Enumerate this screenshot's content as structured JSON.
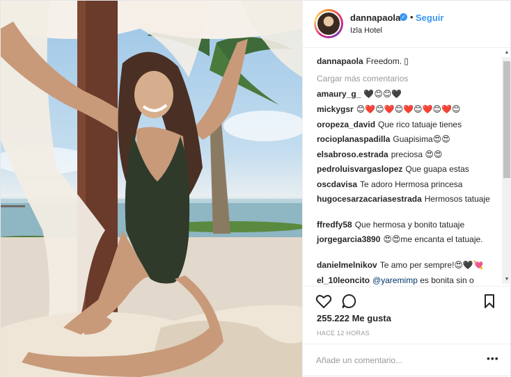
{
  "post": {
    "username": "dannapaola",
    "verified_mark": "✓",
    "separator": "•",
    "follow_label": "Seguir",
    "location": "Izla Hotel",
    "likes": "255.222 Me gusta",
    "time": "HACE 12 HORAS"
  },
  "caption": {
    "user": "dannapaola",
    "text": "Freedom. ▯"
  },
  "load_more": "Cargar más comentarios",
  "comments": [
    {
      "user": "amaury_g_",
      "text": "🖤😊😊🖤"
    },
    {
      "user": "mickygsr",
      "text": "😊❤️😊❤️😊❤️😊❤️😊❤️😊"
    },
    {
      "user": "oropeza_david",
      "text": "Que rico tatuaje tienes"
    },
    {
      "user": "rocioplanaspadilla",
      "text": "Guapisima😍😍"
    },
    {
      "user": "elsabroso.estrada",
      "text": "preciosa 😍😍"
    },
    {
      "user": "pedroluisvargaslopez",
      "text": "Que guapa estas"
    },
    {
      "user": "oscdavisa",
      "text": "Te adoro Hermosa princesa"
    },
    {
      "user": "hugocesarzacariasestrada",
      "text": "Hermosos tatuaje"
    },
    {
      "user": "ffredfy58",
      "text": "Que hermosa y bonito tatuaje"
    },
    {
      "user": "jorgegarcia3890",
      "text": "😍😍me encanta el tatuaje."
    },
    {
      "user": "danielmelnikov",
      "text": "Te amo per sempre!😍🖤💘"
    },
    {
      "user": "el_10leoncito",
      "mention": "@yaremimp",
      "text": "es bonita sin o"
    }
  ],
  "add_comment": {
    "placeholder": "Añade un comentario..."
  },
  "more_options": "•••",
  "icons": {
    "like": "heart-icon",
    "comment": "comment-icon",
    "save": "bookmark-icon",
    "scroll_up": "▲",
    "scroll_down": "▼"
  },
  "colors": {
    "accent": "#3897f0",
    "text": "#262626",
    "muted": "#999999",
    "border": "#efefef"
  }
}
